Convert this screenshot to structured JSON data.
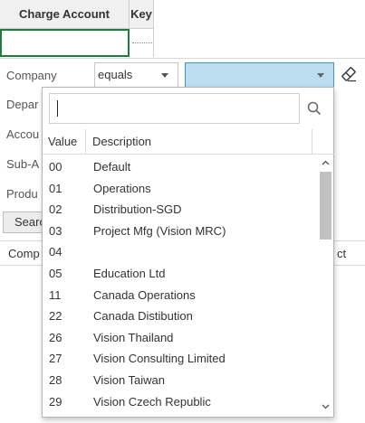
{
  "grid": {
    "columns": [
      "Charge Account",
      "Key"
    ]
  },
  "filter_panel": {
    "labels": [
      "Company",
      "Depar",
      "Accou",
      "Sub-A",
      "Produ"
    ],
    "operator": "equals",
    "search_button": "Search",
    "bottom_left": "Comp",
    "bottom_right": "ct"
  },
  "dropdown": {
    "search_value": "",
    "columns": [
      "Value",
      "Description"
    ],
    "rows": [
      {
        "value": "00",
        "description": "Default"
      },
      {
        "value": "01",
        "description": "Operations"
      },
      {
        "value": "02",
        "description": "Distribution-SGD"
      },
      {
        "value": "03",
        "description": "Project Mfg (Vision MRC)"
      },
      {
        "value": "04",
        "description": ""
      },
      {
        "value": "05",
        "description": "Education Ltd"
      },
      {
        "value": "11",
        "description": "Canada Operations"
      },
      {
        "value": "22",
        "description": "Canada Distibution"
      },
      {
        "value": "26",
        "description": "Vision Thailand"
      },
      {
        "value": "27",
        "description": "Vision Consulting Limited"
      },
      {
        "value": "28",
        "description": "Vision Taiwan"
      },
      {
        "value": "29",
        "description": "Vision Czech Republic"
      }
    ]
  },
  "icons": {
    "eraser": "eraser-icon",
    "search": "search-icon"
  },
  "colors": {
    "focus_border": "#1e7d3c",
    "selected_value_bg": "#bcdcf0"
  }
}
